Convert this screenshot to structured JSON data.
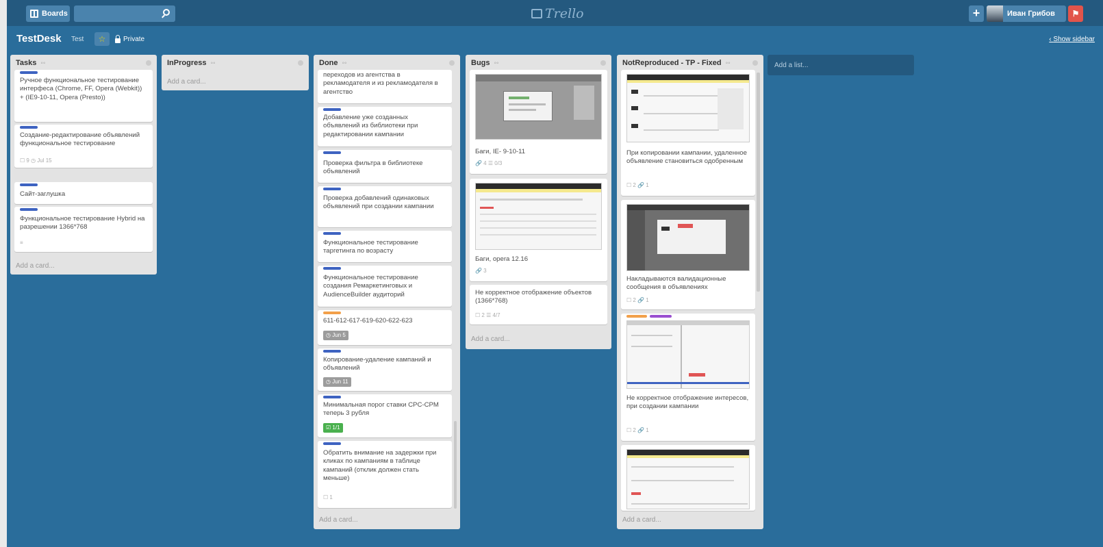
{
  "header": {
    "boards_label": "Boards",
    "logo_text": "Trello",
    "user_name": "Иван Грибов",
    "add_label": "+"
  },
  "board": {
    "title": "TestDesk",
    "org": "Test",
    "visibility": "Private",
    "show_sidebar": "Show sidebar",
    "add_list": "Add a list..."
  },
  "add_card_label": "Add a card...",
  "colors": {
    "background": "#2a6d9b",
    "topbar": "#24597f",
    "label_blue": "#3e63c1",
    "label_orange": "#f2a04a",
    "label_purple": "#9a4fd0",
    "due_badge": "#9c9c9c",
    "checklist_badge": "#4ab04e"
  },
  "lists": [
    {
      "title": "Tasks",
      "cards": [
        {
          "text": "Ручное функциональное тестирование интерфеса (Chrome, FF, Opera (Webkit)) + (IE9-10-11, Opera (Presto))"
        },
        {
          "text": "Создание-редактирование объявлений функциональное тестирование",
          "meta": "☐ 9  ◷ Jul 15"
        },
        {
          "text": "Сайт-заглушка"
        },
        {
          "text": "Функциональное тестирование Hybrid на разрешении 1366*768",
          "meta": "≡"
        }
      ]
    },
    {
      "title": "InProgress",
      "cards": []
    },
    {
      "title": "Done",
      "cards": [
        {
          "text": "переходов из агентства в рекламодателя и из рекламодателя в агентство"
        },
        {
          "text": "Добавление уже созданных объявлений из библиотеки при редактировании кампании"
        },
        {
          "text": "Проверка фильтра в библиотеке объявлений"
        },
        {
          "text": "Проверка добавлений одинаковых объявлений при создании кампании"
        },
        {
          "text": "Функциональное тестирование таргетинга по возрасту"
        },
        {
          "text": "Функциональное тестирование создания Ремаркетинговых и AudienceBuilder аудиторий"
        },
        {
          "text": "611-612-617-619-620-622-623",
          "badge": "◷ Jun 5"
        },
        {
          "text": "Копирование-удаление кампаний и объявлений",
          "badge": "◷ Jun 11"
        },
        {
          "text": "Минимальная порог ставки CPC-CPM теперь 3 рубля",
          "badge": "☑ 1/1"
        },
        {
          "text": "Обратить внимание на задержки при кликах по кампаниям в таблице кампаний (отклик должен стать меньше)",
          "meta": "☐ 1"
        }
      ]
    },
    {
      "title": "Bugs",
      "cards": [
        {
          "text": "Баги, IE- 9-10-11",
          "meta": "🔗 4  ☰ 0/3"
        },
        {
          "text": "Баги, opera 12.16",
          "meta": "🔗 3"
        },
        {
          "text": "Не корректное отображение объектов (1366*768)",
          "meta": "☐ 2  ☰ 4/7"
        }
      ]
    },
    {
      "title": "NotReproduced - TP - Fixed",
      "cards": [
        {
          "text": "При копировании кампании, удаленное объявление становиться одобренным",
          "meta": "☐ 2  🔗 1"
        },
        {
          "text": "Накладываются валидационные сообщения в объявлениях",
          "meta": "☐ 2  🔗 1"
        },
        {
          "text": "Не корректное отображение интересов, при создании кампании",
          "meta": "☐ 2  🔗 1"
        },
        {
          "text": ""
        }
      ]
    }
  ]
}
